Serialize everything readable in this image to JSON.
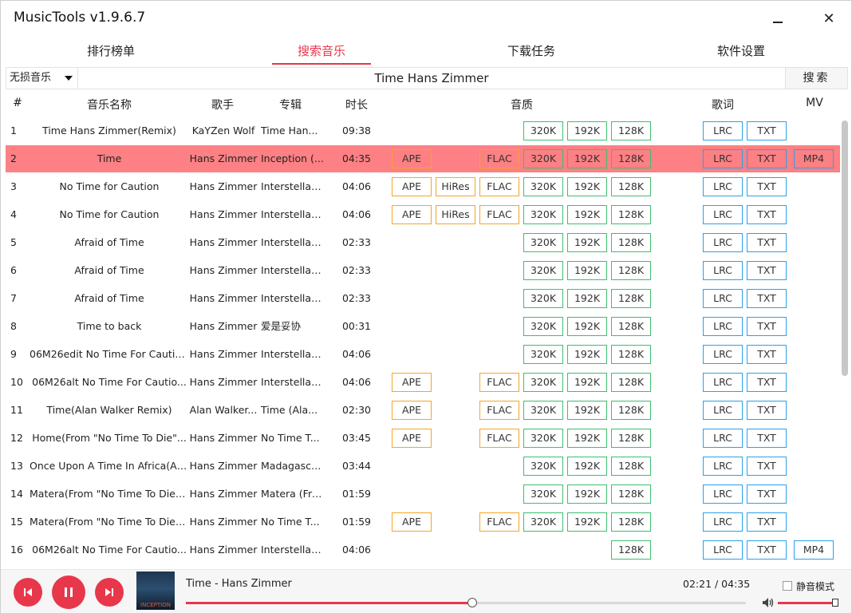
{
  "window": {
    "title": "MusicTools v1.9.6.7",
    "minimize_glyph": "",
    "close_glyph": "✕"
  },
  "tabs": [
    {
      "label": "排行榜单",
      "active": false
    },
    {
      "label": "搜索音乐",
      "active": true
    },
    {
      "label": "下载任务",
      "active": false
    },
    {
      "label": "软件设置",
      "active": false
    }
  ],
  "search": {
    "source_selected": "无损音乐",
    "query": "Time Hans Zimmer",
    "button_label": "搜索"
  },
  "columns": {
    "num": "#",
    "name": "音乐名称",
    "artist": "歌手",
    "album": "专辑",
    "duration": "时长",
    "quality": "音质",
    "lyrics": "歌词",
    "mv": "MV"
  },
  "selected_row_index": 1,
  "rows": [
    {
      "num": "1",
      "name": "Time Hans Zimmer(Remix)",
      "artist": "KaYZen Wolf",
      "album": "Time Han...",
      "duration": "09:38",
      "quality": [
        "320K",
        "192K",
        "128K"
      ],
      "lyrics": [
        "LRC",
        "TXT"
      ],
      "mv": ""
    },
    {
      "num": "2",
      "name": "Time",
      "artist": "Hans Zimmer",
      "album": "Inception (...",
      "duration": "04:35",
      "quality": [
        "APE",
        "FLAC",
        "320K",
        "192K",
        "128K"
      ],
      "lyrics": [
        "LRC",
        "TXT"
      ],
      "mv": "MP4"
    },
    {
      "num": "3",
      "name": "No Time for Caution",
      "artist": "Hans Zimmer",
      "album": "Interstellar (...",
      "duration": "04:06",
      "quality": [
        "APE",
        "HiRes",
        "FLAC",
        "320K",
        "192K",
        "128K"
      ],
      "lyrics": [
        "LRC",
        "TXT"
      ],
      "mv": ""
    },
    {
      "num": "4",
      "name": "No Time for Caution",
      "artist": "Hans Zimmer",
      "album": "Interstellar (...",
      "duration": "04:06",
      "quality": [
        "APE",
        "HiRes",
        "FLAC",
        "320K",
        "192K",
        "128K"
      ],
      "lyrics": [
        "LRC",
        "TXT"
      ],
      "mv": ""
    },
    {
      "num": "5",
      "name": "Afraid of Time",
      "artist": "Hans Zimmer",
      "album": "Interstellar (...",
      "duration": "02:33",
      "quality": [
        "320K",
        "192K",
        "128K"
      ],
      "lyrics": [
        "LRC",
        "TXT"
      ],
      "mv": ""
    },
    {
      "num": "6",
      "name": "Afraid of Time",
      "artist": "Hans Zimmer",
      "album": "Interstellar (...",
      "duration": "02:33",
      "quality": [
        "320K",
        "192K",
        "128K"
      ],
      "lyrics": [
        "LRC",
        "TXT"
      ],
      "mv": ""
    },
    {
      "num": "7",
      "name": "Afraid of Time",
      "artist": "Hans Zimmer",
      "album": "Interstellar (...",
      "duration": "02:33",
      "quality": [
        "320K",
        "192K",
        "128K"
      ],
      "lyrics": [
        "LRC",
        "TXT"
      ],
      "mv": ""
    },
    {
      "num": "8",
      "name": "Time to back",
      "artist": "Hans Zimmer",
      "album": "爱是妥协",
      "duration": "00:31",
      "quality": [
        "320K",
        "192K",
        "128K"
      ],
      "lyrics": [
        "LRC",
        "TXT"
      ],
      "mv": ""
    },
    {
      "num": "9",
      "name": "06M26edit No Time For Cautio...",
      "artist": "Hans Zimmer",
      "album": "Interstellar (...",
      "duration": "04:06",
      "quality": [
        "320K",
        "192K",
        "128K"
      ],
      "lyrics": [
        "LRC",
        "TXT"
      ],
      "mv": ""
    },
    {
      "num": "10",
      "name": "06M26alt No Time For Cautio...",
      "artist": "Hans Zimmer",
      "album": "Interstellar (...",
      "duration": "04:06",
      "quality": [
        "APE",
        "FLAC",
        "320K",
        "192K",
        "128K"
      ],
      "lyrics": [
        "LRC",
        "TXT"
      ],
      "mv": ""
    },
    {
      "num": "11",
      "name": "Time(Alan Walker Remix)",
      "artist": "Alan Walker...",
      "album": "Time (Ala...",
      "duration": "02:30",
      "quality": [
        "APE",
        "FLAC",
        "320K",
        "192K",
        "128K"
      ],
      "lyrics": [
        "LRC",
        "TXT"
      ],
      "mv": ""
    },
    {
      "num": "12",
      "name": "Home(From \"No Time To Die\"...",
      "artist": "Hans Zimmer",
      "album": "No Time T...",
      "duration": "03:45",
      "quality": [
        "APE",
        "FLAC",
        "320K",
        "192K",
        "128K"
      ],
      "lyrics": [
        "LRC",
        "TXT"
      ],
      "mv": ""
    },
    {
      "num": "13",
      "name": "Once Upon A Time In Africa(Al...",
      "artist": "Hans Zimmer",
      "album": "Madagascar...",
      "duration": "03:44",
      "quality": [
        "320K",
        "192K",
        "128K"
      ],
      "lyrics": [
        "LRC",
        "TXT"
      ],
      "mv": ""
    },
    {
      "num": "14",
      "name": "Matera(From \"No Time To Die\"...",
      "artist": "Hans Zimmer",
      "album": "Matera (Fro...",
      "duration": "01:59",
      "quality": [
        "320K",
        "192K",
        "128K"
      ],
      "lyrics": [
        "LRC",
        "TXT"
      ],
      "mv": ""
    },
    {
      "num": "15",
      "name": "Matera(From \"No Time To Die\"...",
      "artist": "Hans Zimmer",
      "album": "No Time T...",
      "duration": "01:59",
      "quality": [
        "APE",
        "FLAC",
        "320K",
        "192K",
        "128K"
      ],
      "lyrics": [
        "LRC",
        "TXT"
      ],
      "mv": ""
    },
    {
      "num": "16",
      "name": "06M26alt No Time For Cautio...",
      "artist": "Hans Zimmer",
      "album": "Interstellar (...",
      "duration": "04:06",
      "quality": [
        "128K"
      ],
      "lyrics": [
        "LRC",
        "TXT"
      ],
      "mv": "MP4"
    }
  ],
  "player": {
    "now_playing": "Time - Hans Zimmer",
    "time_readout": "02:21 / 04:35",
    "progress_fraction": 0.512,
    "volume_fraction": 1.0,
    "mute_label": "静音模式",
    "mute_checked": false,
    "cover_text": "INCEPTION"
  },
  "colors": {
    "accent": "#e8374b",
    "selected_row": "#fc8084",
    "tag_orange": "#f5a623",
    "tag_green": "#3cbf70",
    "tag_blue": "#2aa2e8"
  }
}
